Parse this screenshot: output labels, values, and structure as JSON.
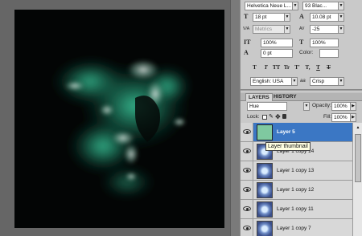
{
  "character_panel": {
    "font_family": "Helvetica Neue L...",
    "font_style": "93 Blac...",
    "font_size": "18 pt",
    "leading": "10.08 pt",
    "kerning": "Metrics",
    "tracking": "-25",
    "vertical_scale": "100%",
    "horizontal_scale": "100%",
    "baseline_shift": "0 pt",
    "color_label": "Color:",
    "icon_size": "T",
    "icon_leading": "A",
    "icon_kerning": "V/A",
    "icon_tracking": "AV",
    "icon_vscale": "IT",
    "icon_hscale": "T",
    "icon_baseline": "A",
    "type_buttons": [
      "T",
      "T",
      "TT",
      "Tr",
      "T'",
      "T,",
      "T",
      "T"
    ],
    "language": "English: USA",
    "aa_icon": "aa",
    "antialias": "Crisp"
  },
  "layers_panel": {
    "tabs": [
      "LAYERS",
      "HISTORY"
    ],
    "blend_mode": "Hue",
    "opacity_label": "Opacity:",
    "opacity_value": "100%",
    "lock_label": "Lock:",
    "fill_label": "Fill:",
    "fill_value": "100%",
    "layers": [
      {
        "name": "Layer 5"
      },
      {
        "name": "Layer 1 copy 14"
      },
      {
        "name": "Layer 1 copy 13"
      },
      {
        "name": "Layer 1 copy 12"
      },
      {
        "name": "Layer 1 copy 11"
      },
      {
        "name": "Layer 1 copy 7"
      }
    ],
    "tooltip": "Layer thumbnail"
  },
  "colors": {
    "selection": "#3b77c4",
    "smoke": "#2fb68c",
    "swatch": "#7fc9a0"
  }
}
